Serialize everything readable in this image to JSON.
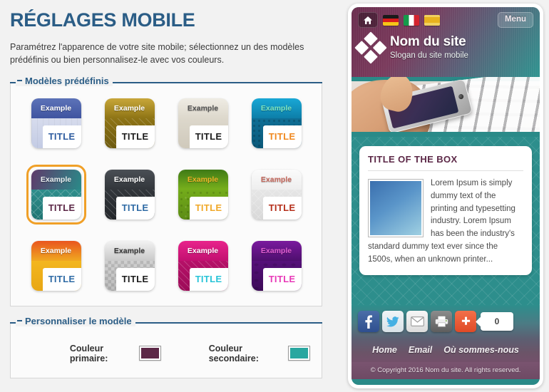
{
  "page": {
    "title": "RÉGLAGES MOBILE",
    "description": "Paramétrez l'apparence de votre site mobile; sélectionnez un des modèles prédéfinis ou bien personnalisez-le avec vos couleurs."
  },
  "predefined": {
    "legend": "Modèles prédéfinis",
    "templates": [
      {
        "id": "blue-light",
        "header_label": "Example",
        "title_label": "TITLE",
        "selected": false,
        "header_bg": "linear-gradient(180deg,#5d73b8,#3f54a0)",
        "header_text": "#ffffff",
        "body_bg": "linear-gradient(180deg,#d7dced,#c3cbe4)",
        "title_text": "#2f5da0",
        "pattern": "pat-vstripe"
      },
      {
        "id": "gold",
        "header_label": "Example",
        "title_label": "TITLE",
        "selected": false,
        "header_bg": "linear-gradient(180deg,#c8a73a,#8e7415)",
        "header_text": "#ffffff",
        "body_bg": "linear-gradient(180deg,#8e7415,#6d5a10)",
        "title_text": "#1d1d1d",
        "pattern": "pat-diag"
      },
      {
        "id": "cream",
        "header_label": "Example",
        "title_label": "TITLE",
        "selected": false,
        "header_bg": "linear-gradient(180deg,#efece4,#ddd8cc)",
        "header_text": "#555555",
        "body_bg": "linear-gradient(180deg,#ddd8cc,#cfc9bb)",
        "title_text": "#1d1d1d",
        "pattern": "pat-none"
      },
      {
        "id": "cyan",
        "header_label": "Example",
        "title_label": "TITLE",
        "selected": false,
        "header_bg": "linear-gradient(180deg,#19a8d6,#0d7ea8)",
        "header_text": "#7fe6c0",
        "body_bg": "linear-gradient(180deg,#0f6f96,#0b5878)",
        "title_text": "#f08a22",
        "pattern": "pat-dots"
      },
      {
        "id": "purple-teal",
        "header_label": "Example",
        "title_label": "TITLE",
        "selected": true,
        "header_bg": "linear-gradient(110deg,#5f3a6a,#3f6a7d 60%,#2a8a88)",
        "header_text": "#e8eef0",
        "body_bg": "linear-gradient(180deg,#2f8e8c,#1f7472)",
        "title_text": "#5c2847",
        "pattern": "pat-diamond"
      },
      {
        "id": "charcoal",
        "header_label": "Example",
        "title_label": "TITLE",
        "selected": false,
        "header_bg": "linear-gradient(180deg,#4a4f55,#32363b)",
        "header_text": "#ffffff",
        "body_bg": "linear-gradient(180deg,#32363b,#24272b)",
        "title_text": "#2f6ba5",
        "pattern": "pat-diag"
      },
      {
        "id": "green",
        "header_label": "Example",
        "title_label": "TITLE",
        "selected": false,
        "header_bg": "linear-gradient(180deg,#3f7a16,#78b01c)",
        "header_text": "#f0b429",
        "body_bg": "linear-gradient(180deg,#74ac1b,#5c8c14)",
        "title_text": "#f0a92a",
        "pattern": "pat-organic"
      },
      {
        "id": "white-red",
        "header_label": "Example",
        "title_label": "TITLE",
        "selected": false,
        "header_bg": "linear-gradient(180deg,#fbfbfb,#eeeeee)",
        "header_text": "#c96a5e",
        "body_bg": "linear-gradient(180deg,#e6e6e6,#d8d8d8)",
        "title_text": "#b5301c",
        "pattern": "pat-diamond"
      },
      {
        "id": "orange",
        "header_label": "Example",
        "title_label": "TITLE",
        "selected": false,
        "header_bg": "linear-gradient(180deg,#e9561f,#f0a821)",
        "header_text": "#ffffff",
        "body_bg": "linear-gradient(180deg,#f3b61f,#e8a715)",
        "title_text": "#2f6ba5",
        "pattern": "pat-none"
      },
      {
        "id": "silver",
        "header_label": "Example",
        "title_label": "TITLE",
        "selected": false,
        "header_bg": "linear-gradient(180deg,#f2f2f2,#c9c9c9)",
        "header_text": "#3a3a3a",
        "body_bg": "linear-gradient(180deg,#d0d0d0,#bdbdbd)",
        "title_text": "#1d1d1d",
        "pattern": "pat-check"
      },
      {
        "id": "magenta",
        "header_label": "Example",
        "title_label": "TITLE",
        "selected": false,
        "header_bg": "linear-gradient(180deg,#e8248c,#c21070)",
        "header_text": "#ffffff",
        "body_bg": "linear-gradient(180deg,#b61068,#9c0c58)",
        "title_text": "#29c4d8",
        "pattern": "pat-diag"
      },
      {
        "id": "violet",
        "header_label": "Example",
        "title_label": "TITLE",
        "selected": false,
        "header_bg": "linear-gradient(180deg,#7a1a9e,#4e0f6e)",
        "header_text": "#e060d0",
        "body_bg": "linear-gradient(180deg,#56107a,#3d0b58)",
        "title_text": "#e83ab8",
        "pattern": "pat-blob"
      }
    ]
  },
  "customize": {
    "legend": "Personnaliser le modèle",
    "primary_label": "Couleur primaire:",
    "primary_color": "#5c2847",
    "secondary_label": "Couleur secondaire:",
    "secondary_color": "#2aa7a0"
  },
  "preview": {
    "home_icon": "home-icon",
    "flags": [
      {
        "name": "flag-de",
        "title": "Deutsch"
      },
      {
        "name": "flag-it",
        "title": "Italiano"
      },
      {
        "name": "flag-es",
        "title": "Espanol"
      }
    ],
    "menu_label": "Menu",
    "site_name": "Nom du site",
    "slogan": "Slogan du site mobile",
    "box": {
      "title": "TITLE OF THE BOX",
      "text": "Lorem Ipsum is simply dummy text of the printing and typesetting industry. Lorem Ipsum has been the industry's standard dummy text ever since the 1500s, when an unknown printer..."
    },
    "social": [
      {
        "name": "facebook-icon"
      },
      {
        "name": "twitter-icon"
      },
      {
        "name": "email-icon"
      },
      {
        "name": "print-icon"
      },
      {
        "name": "share-plus-icon"
      }
    ],
    "share_count": "0",
    "nav": [
      "Home",
      "Email",
      "Où sommes-nous"
    ],
    "copyright": "© Copyright 2016 Nom du site. All rights reserved."
  }
}
